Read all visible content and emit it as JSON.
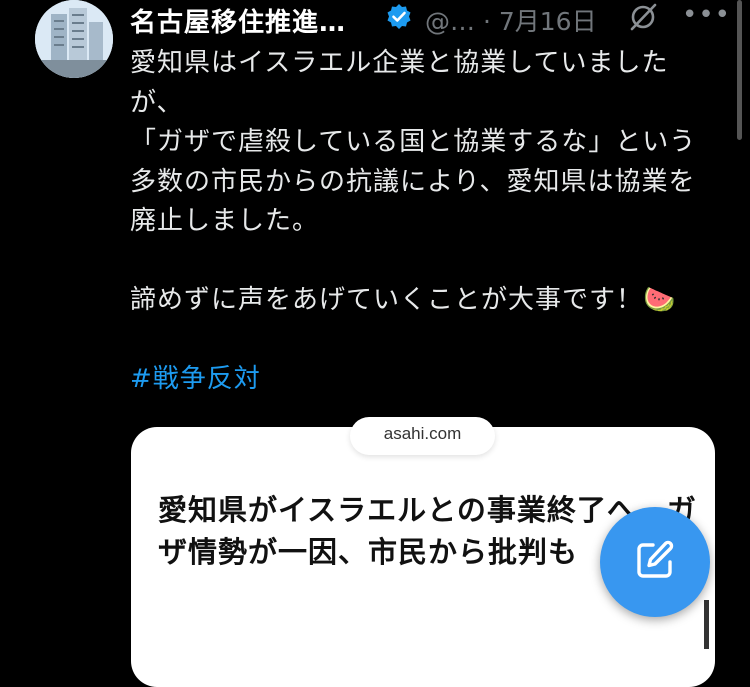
{
  "post": {
    "author_name": "名古屋移住推進…",
    "handle": "@…",
    "separator": "·",
    "date": "7月16日",
    "more_label": "•••",
    "text_lines": [
      "愛知県はイスラエル企業と協業していましたが、\n「ガザで虐殺している国と協業するな」という多数の市民からの抗議により、愛知県は協業を廃止しました。",
      "諦めずに声をあげていくことが大事です！🍉"
    ],
    "hashtag": "#戦争反対"
  },
  "link_card": {
    "domain": "asahi.com",
    "title": "愛知県がイスラエルとの事業終了へ　ガザ情勢が一因、市民から批判も"
  },
  "icons": {
    "verified": "verified-badge-icon",
    "grok": "grok-icon",
    "compose": "compose-icon",
    "more": "more-icon"
  },
  "colors": {
    "background": "#000000",
    "hashtag": "#1d9bf0",
    "fab": "#3897f0",
    "verified": "#1d9bf0"
  }
}
